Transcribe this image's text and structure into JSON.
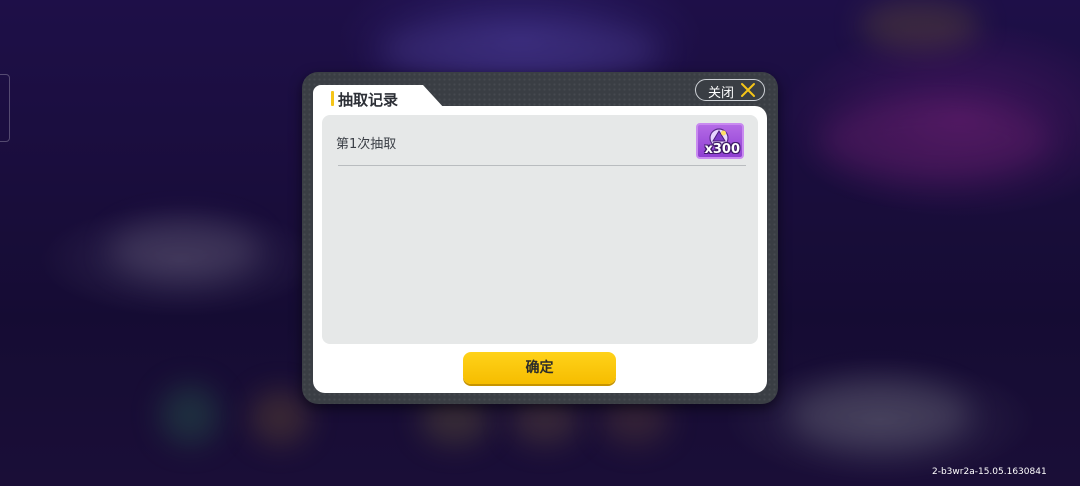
{
  "dialog": {
    "title": "抽取记录",
    "close_label": "关闭",
    "confirm_label": "确定",
    "records": [
      {
        "label": "第1次抽取",
        "reward_icon": "purple-gem-icon",
        "reward_count": "x300"
      }
    ]
  },
  "build_version": "2-b3wr2a-15.05.1630841",
  "colors": {
    "accent_yellow": "#f5c518",
    "confirm_button": "#ffd21a",
    "reward_frame": "#a552dc",
    "dialog_frame": "#3a3e44"
  }
}
